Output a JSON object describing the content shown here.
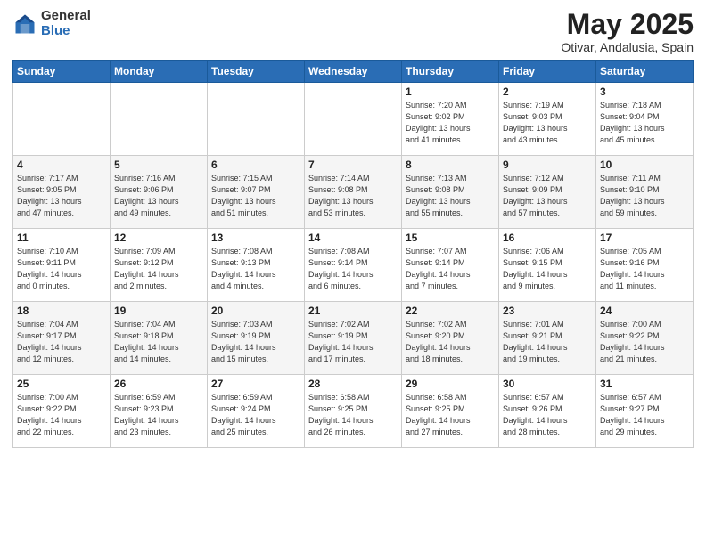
{
  "logo": {
    "general": "General",
    "blue": "Blue"
  },
  "title": {
    "month_year": "May 2025",
    "location": "Otivar, Andalusia, Spain"
  },
  "weekdays": [
    "Sunday",
    "Monday",
    "Tuesday",
    "Wednesday",
    "Thursday",
    "Friday",
    "Saturday"
  ],
  "weeks": [
    [
      {
        "day": "",
        "info": ""
      },
      {
        "day": "",
        "info": ""
      },
      {
        "day": "",
        "info": ""
      },
      {
        "day": "",
        "info": ""
      },
      {
        "day": "1",
        "info": "Sunrise: 7:20 AM\nSunset: 9:02 PM\nDaylight: 13 hours\nand 41 minutes."
      },
      {
        "day": "2",
        "info": "Sunrise: 7:19 AM\nSunset: 9:03 PM\nDaylight: 13 hours\nand 43 minutes."
      },
      {
        "day": "3",
        "info": "Sunrise: 7:18 AM\nSunset: 9:04 PM\nDaylight: 13 hours\nand 45 minutes."
      }
    ],
    [
      {
        "day": "4",
        "info": "Sunrise: 7:17 AM\nSunset: 9:05 PM\nDaylight: 13 hours\nand 47 minutes."
      },
      {
        "day": "5",
        "info": "Sunrise: 7:16 AM\nSunset: 9:06 PM\nDaylight: 13 hours\nand 49 minutes."
      },
      {
        "day": "6",
        "info": "Sunrise: 7:15 AM\nSunset: 9:07 PM\nDaylight: 13 hours\nand 51 minutes."
      },
      {
        "day": "7",
        "info": "Sunrise: 7:14 AM\nSunset: 9:08 PM\nDaylight: 13 hours\nand 53 minutes."
      },
      {
        "day": "8",
        "info": "Sunrise: 7:13 AM\nSunset: 9:08 PM\nDaylight: 13 hours\nand 55 minutes."
      },
      {
        "day": "9",
        "info": "Sunrise: 7:12 AM\nSunset: 9:09 PM\nDaylight: 13 hours\nand 57 minutes."
      },
      {
        "day": "10",
        "info": "Sunrise: 7:11 AM\nSunset: 9:10 PM\nDaylight: 13 hours\nand 59 minutes."
      }
    ],
    [
      {
        "day": "11",
        "info": "Sunrise: 7:10 AM\nSunset: 9:11 PM\nDaylight: 14 hours\nand 0 minutes."
      },
      {
        "day": "12",
        "info": "Sunrise: 7:09 AM\nSunset: 9:12 PM\nDaylight: 14 hours\nand 2 minutes."
      },
      {
        "day": "13",
        "info": "Sunrise: 7:08 AM\nSunset: 9:13 PM\nDaylight: 14 hours\nand 4 minutes."
      },
      {
        "day": "14",
        "info": "Sunrise: 7:08 AM\nSunset: 9:14 PM\nDaylight: 14 hours\nand 6 minutes."
      },
      {
        "day": "15",
        "info": "Sunrise: 7:07 AM\nSunset: 9:14 PM\nDaylight: 14 hours\nand 7 minutes."
      },
      {
        "day": "16",
        "info": "Sunrise: 7:06 AM\nSunset: 9:15 PM\nDaylight: 14 hours\nand 9 minutes."
      },
      {
        "day": "17",
        "info": "Sunrise: 7:05 AM\nSunset: 9:16 PM\nDaylight: 14 hours\nand 11 minutes."
      }
    ],
    [
      {
        "day": "18",
        "info": "Sunrise: 7:04 AM\nSunset: 9:17 PM\nDaylight: 14 hours\nand 12 minutes."
      },
      {
        "day": "19",
        "info": "Sunrise: 7:04 AM\nSunset: 9:18 PM\nDaylight: 14 hours\nand 14 minutes."
      },
      {
        "day": "20",
        "info": "Sunrise: 7:03 AM\nSunset: 9:19 PM\nDaylight: 14 hours\nand 15 minutes."
      },
      {
        "day": "21",
        "info": "Sunrise: 7:02 AM\nSunset: 9:19 PM\nDaylight: 14 hours\nand 17 minutes."
      },
      {
        "day": "22",
        "info": "Sunrise: 7:02 AM\nSunset: 9:20 PM\nDaylight: 14 hours\nand 18 minutes."
      },
      {
        "day": "23",
        "info": "Sunrise: 7:01 AM\nSunset: 9:21 PM\nDaylight: 14 hours\nand 19 minutes."
      },
      {
        "day": "24",
        "info": "Sunrise: 7:00 AM\nSunset: 9:22 PM\nDaylight: 14 hours\nand 21 minutes."
      }
    ],
    [
      {
        "day": "25",
        "info": "Sunrise: 7:00 AM\nSunset: 9:22 PM\nDaylight: 14 hours\nand 22 minutes."
      },
      {
        "day": "26",
        "info": "Sunrise: 6:59 AM\nSunset: 9:23 PM\nDaylight: 14 hours\nand 23 minutes."
      },
      {
        "day": "27",
        "info": "Sunrise: 6:59 AM\nSunset: 9:24 PM\nDaylight: 14 hours\nand 25 minutes."
      },
      {
        "day": "28",
        "info": "Sunrise: 6:58 AM\nSunset: 9:25 PM\nDaylight: 14 hours\nand 26 minutes."
      },
      {
        "day": "29",
        "info": "Sunrise: 6:58 AM\nSunset: 9:25 PM\nDaylight: 14 hours\nand 27 minutes."
      },
      {
        "day": "30",
        "info": "Sunrise: 6:57 AM\nSunset: 9:26 PM\nDaylight: 14 hours\nand 28 minutes."
      },
      {
        "day": "31",
        "info": "Sunrise: 6:57 AM\nSunset: 9:27 PM\nDaylight: 14 hours\nand 29 minutes."
      }
    ]
  ]
}
